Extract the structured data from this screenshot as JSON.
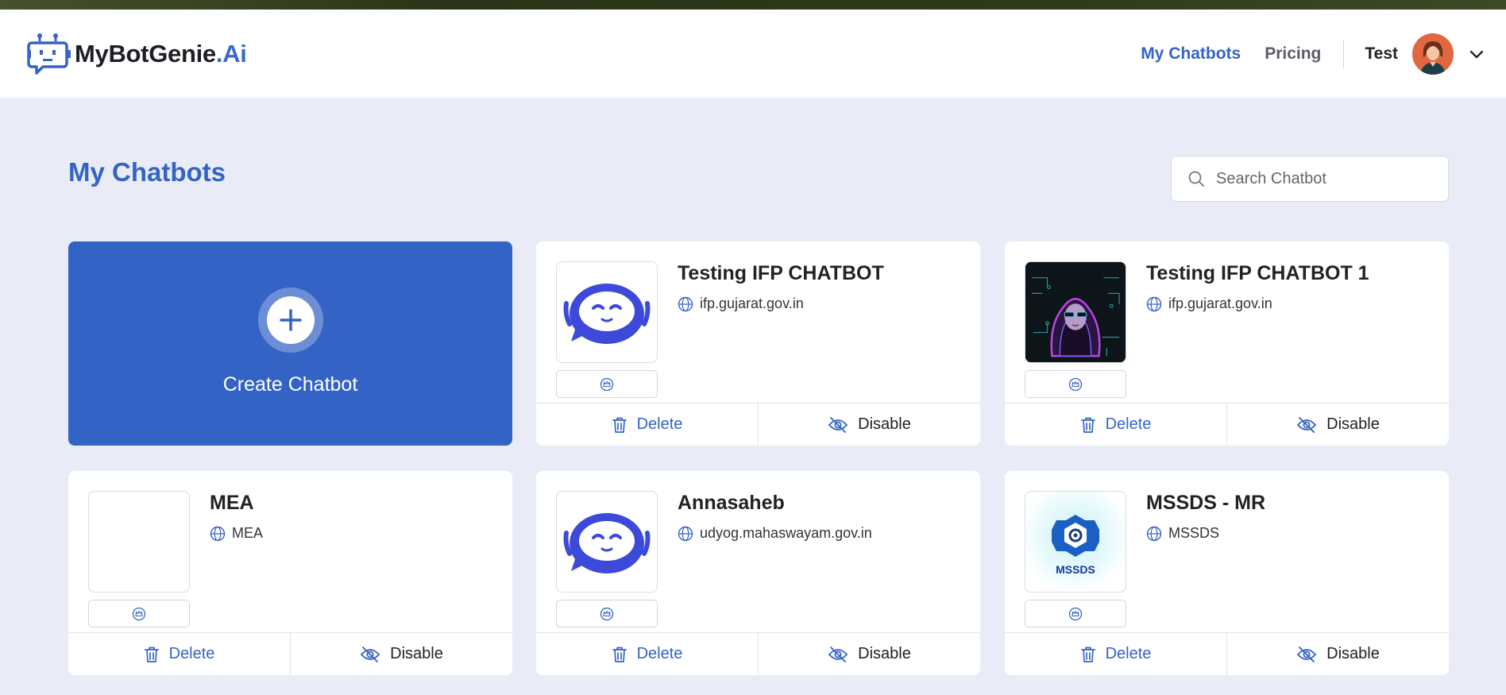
{
  "app": {
    "logo_main": "MyBotGenie",
    "logo_accent": ".Ai",
    "accent_color": "#3463c6"
  },
  "nav": {
    "my_chatbots": "My Chatbots",
    "pricing": "Pricing",
    "user_name": "Test"
  },
  "page": {
    "title": "My Chatbots",
    "search_placeholder": "Search Chatbot"
  },
  "create_card": {
    "label": "Create Chatbot"
  },
  "actions": {
    "delete": "Delete",
    "disable": "Disable"
  },
  "chatbots": [
    {
      "name": "Testing IFP CHATBOT",
      "domain": "ifp.gujarat.gov.in",
      "thumbnail": "robot-avatar"
    },
    {
      "name": "Testing IFP CHATBOT 1",
      "domain": "ifp.gujarat.gov.in",
      "thumbnail": "neon-hooded-figure"
    },
    {
      "name": "MEA",
      "domain": "MEA",
      "thumbnail": "blank"
    },
    {
      "name": "Annasaheb",
      "domain": "udyog.mahaswayam.gov.in",
      "thumbnail": "robot-avatar"
    },
    {
      "name": "MSSDS - MR",
      "domain": "MSSDS",
      "thumbnail": "mssds-logo",
      "thumbnail_text": "MSSDS"
    }
  ]
}
